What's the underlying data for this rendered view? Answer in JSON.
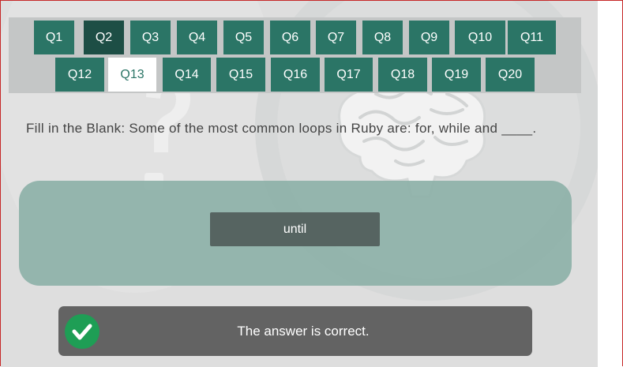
{
  "nav": {
    "questions": [
      "Q1",
      "Q2",
      "Q3",
      "Q4",
      "Q5",
      "Q6",
      "Q7",
      "Q8",
      "Q9",
      "Q10",
      "Q11",
      "Q12",
      "Q13",
      "Q14",
      "Q15",
      "Q16",
      "Q17",
      "Q18",
      "Q19",
      "Q20"
    ],
    "visited": "Q2",
    "active": "Q13"
  },
  "question": {
    "text": "Fill in the Blank: Some of the most common loops in Ruby are: for, while and ____."
  },
  "answer": {
    "label": "until"
  },
  "feedback": {
    "text": "The answer is correct.",
    "icon": "check-icon",
    "status_color": "#1e9e55"
  },
  "colors": {
    "accent": "#2b7566",
    "accent_visited": "#1d4e45",
    "panel": "#8fb2aa",
    "answer_button": "#566461",
    "feedback_bg": "#636363"
  }
}
